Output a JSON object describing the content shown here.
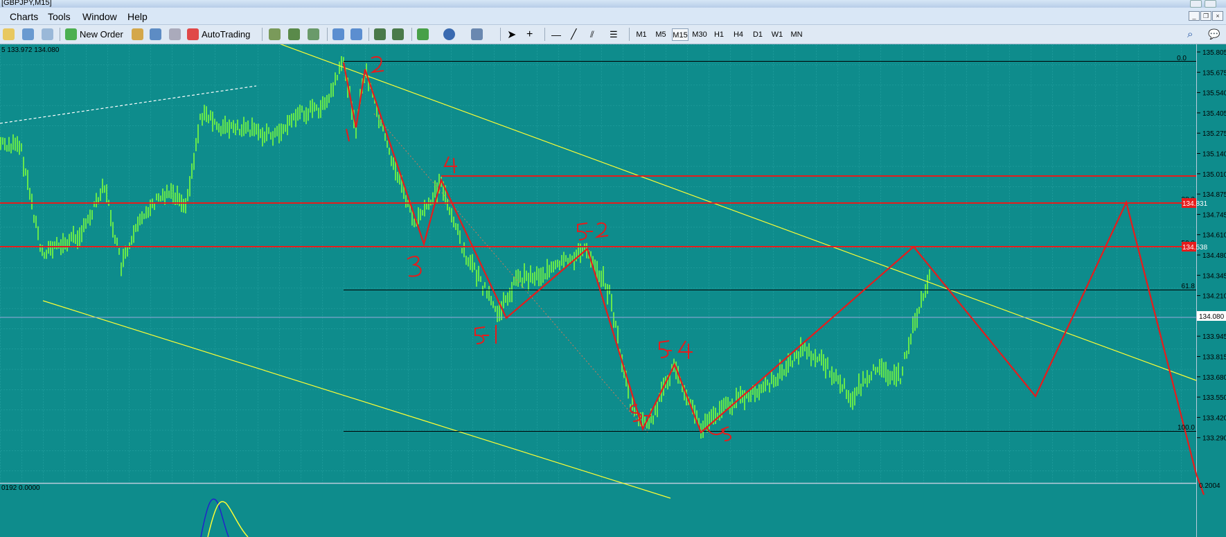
{
  "window": {
    "title": "[GBPJPY,M15]"
  },
  "menu": [
    "Charts",
    "Tools",
    "Window",
    "Help"
  ],
  "toolbar": {
    "new_order": "New Order",
    "autotrading": "AutoTrading",
    "timeframes": [
      "M1",
      "M5",
      "M15",
      "M30",
      "H1",
      "H4",
      "D1",
      "W1",
      "MN"
    ],
    "active_timeframe": "M15"
  },
  "chart": {
    "info": "5 133.972 134.080",
    "price_axis": [
      "135.805",
      "135.675",
      "135.540",
      "135.405",
      "135.275",
      "135.140",
      "135.010",
      "134.875",
      "134.745",
      "134.610",
      "134.480",
      "134.345",
      "134.210",
      "134.080",
      "133.945",
      "133.815",
      "133.680",
      "133.550",
      "133.420",
      "133.290"
    ],
    "current_price": "134.080",
    "hline_labels": {
      "h1": "134.831",
      "h2": "134.538"
    },
    "fib_levels": [
      "0.0",
      "38.2",
      "50.0",
      "61.8",
      "100.0"
    ],
    "wave_labels": [
      "1",
      "2",
      "3",
      "4",
      "5-1",
      "5-2",
      "5-3",
      "5-4",
      "5-5"
    ],
    "colors": {
      "background": "#0e8c8c",
      "candles": "#7cff3c",
      "annotations": "#e61c1c",
      "trendlines": "#ffff33"
    }
  },
  "indicator": {
    "info": "0192 0.0000",
    "value": "0.2004"
  }
}
